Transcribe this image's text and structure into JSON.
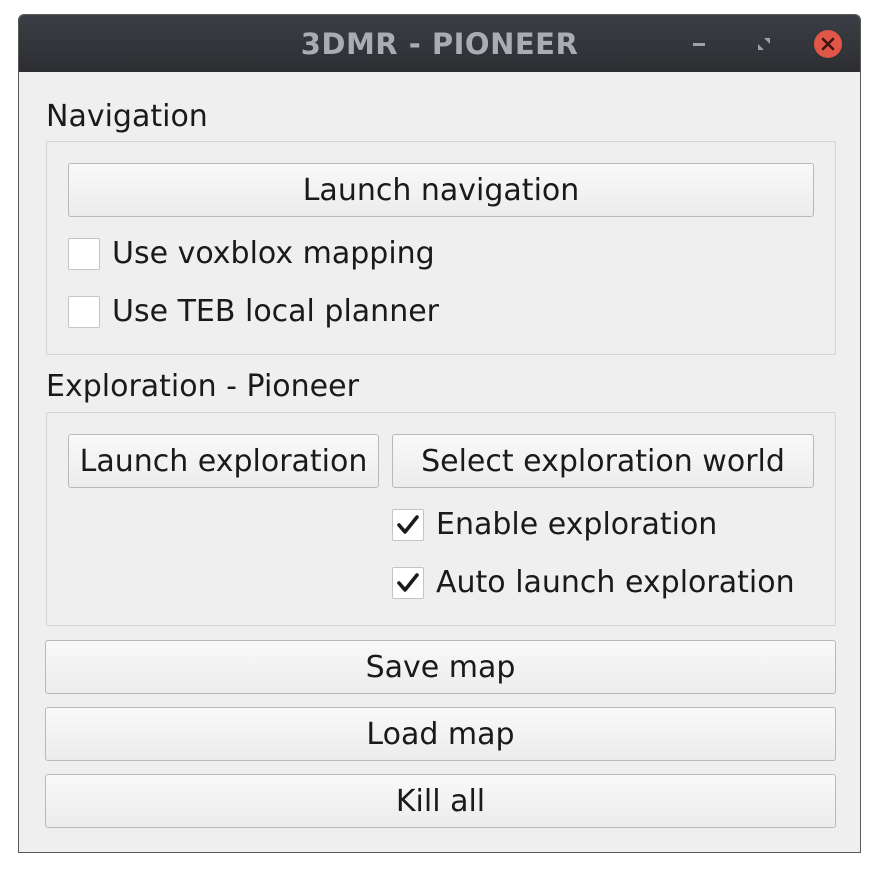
{
  "window": {
    "title": "3DMR - PIONEER",
    "controls": {
      "minimize_icon": "minimize-icon",
      "maximize_icon": "maximize-icon",
      "close_icon": "close-icon",
      "close_color": "#e0574a"
    }
  },
  "navigation": {
    "label": "Navigation",
    "launch_button": "Launch navigation",
    "options": [
      {
        "label": "Use voxblox mapping",
        "checked": false
      },
      {
        "label": "Use TEB local planner",
        "checked": false
      }
    ]
  },
  "exploration": {
    "label": "Exploration - Pioneer",
    "launch_button": "Launch exploration",
    "select_world_button": "Select exploration world",
    "options": [
      {
        "label": "Enable exploration",
        "checked": true
      },
      {
        "label": "Auto launch exploration",
        "checked": true
      }
    ]
  },
  "actions": {
    "save_map": "Save map",
    "load_map": "Load map",
    "kill_all": "Kill all"
  }
}
